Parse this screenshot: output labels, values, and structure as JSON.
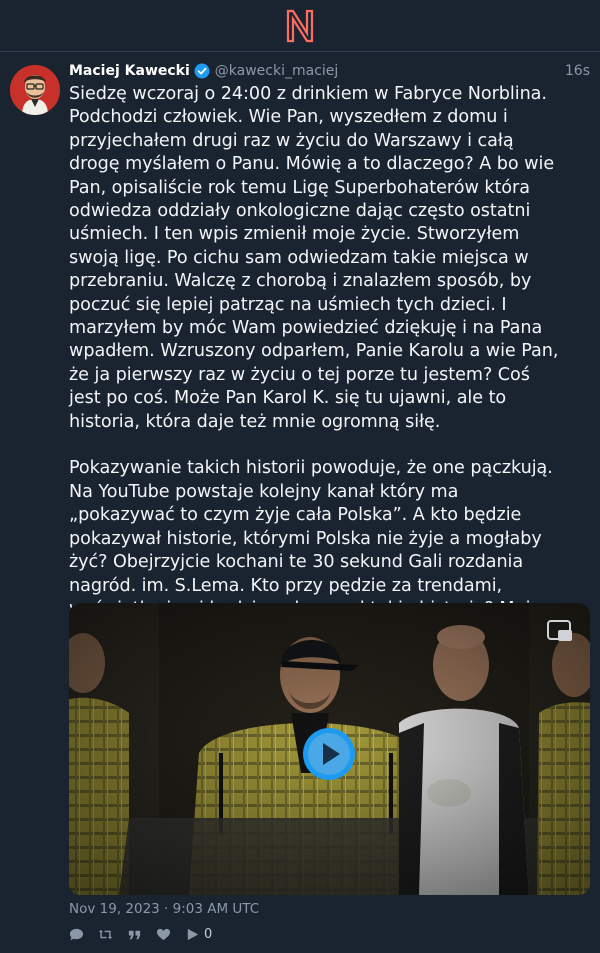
{
  "topbar": {
    "logo_icon": "nitter-n-logo-icon",
    "logo_color": "#ff6c60"
  },
  "tweet": {
    "author_name": "Maciej Kawecki",
    "handle": "@kawecki_maciej",
    "time": "16s",
    "verified_icon": "verified-badge-icon",
    "paragraphs": [
      "Siedzę wczoraj o 24:00 z drinkiem w Fabryce Norblina. Podchodzi człowiek. Wie Pan, wyszedłem z domu i przyjechałem drugi raz w życiu do Warszawy i całą drogę myślałem o Panu. Mówię a to dlaczego? A bo wie Pan, opisaliście rok temu Ligę Superbohaterów która odwiedza oddziały onkologiczne dając często ostatni uśmiech. I ten wpis zmienił moje życie. Stworzyłem swoją ligę. Po cichu sam odwiedzam takie miejsca w przebraniu. Walczę z chorobą i znalazłem sposób, by poczuć się lepiej patrząc na uśmiech tych dzieci. I marzyłem by móc Wam powiedzieć dziękuję i na Pana wpadłem. Wzruszony odparłem, Panie Karolu a wie Pan, że ja pierwszy raz w życiu o tej porze tu jestem? Coś jest po coś. Może Pan Karol K. się tu ujawni, ale to historia, która daje też mnie ogromną siłę.",
      "Pokazywanie takich historii powoduje, że one pączkują. Na YouTube powstaje kolejny kanał który ma „pokazywać to czym żyje cała Polska”. A kto będzie pokazywał historie, którymi Polska nie żyje a mogłaby żyć? Obejrzyjcie kochani te 30 sekund Gali rozdania nagród. im. S.Lema. Kto przy pędzie za trendami, wyświetleniami będzie pokazywał takie historie? Mnie to szczerze załamuje."
    ],
    "date": "Nov 19, 2023 · 9:03 AM UTC",
    "video": {
      "play_icon": "play-icon",
      "pip_icon": "picture-in-picture-icon"
    },
    "actions": [
      {
        "icon": "comment-icon",
        "count": ""
      },
      {
        "icon": "retweet-icon",
        "count": ""
      },
      {
        "icon": "quote-icon",
        "count": ""
      },
      {
        "icon": "heart-icon",
        "count": ""
      },
      {
        "icon": "play-count-icon",
        "count": "0"
      }
    ],
    "colors": {
      "background": "#1a2431",
      "accent": "#1d9bf0",
      "muted": "#8b98a7"
    }
  }
}
